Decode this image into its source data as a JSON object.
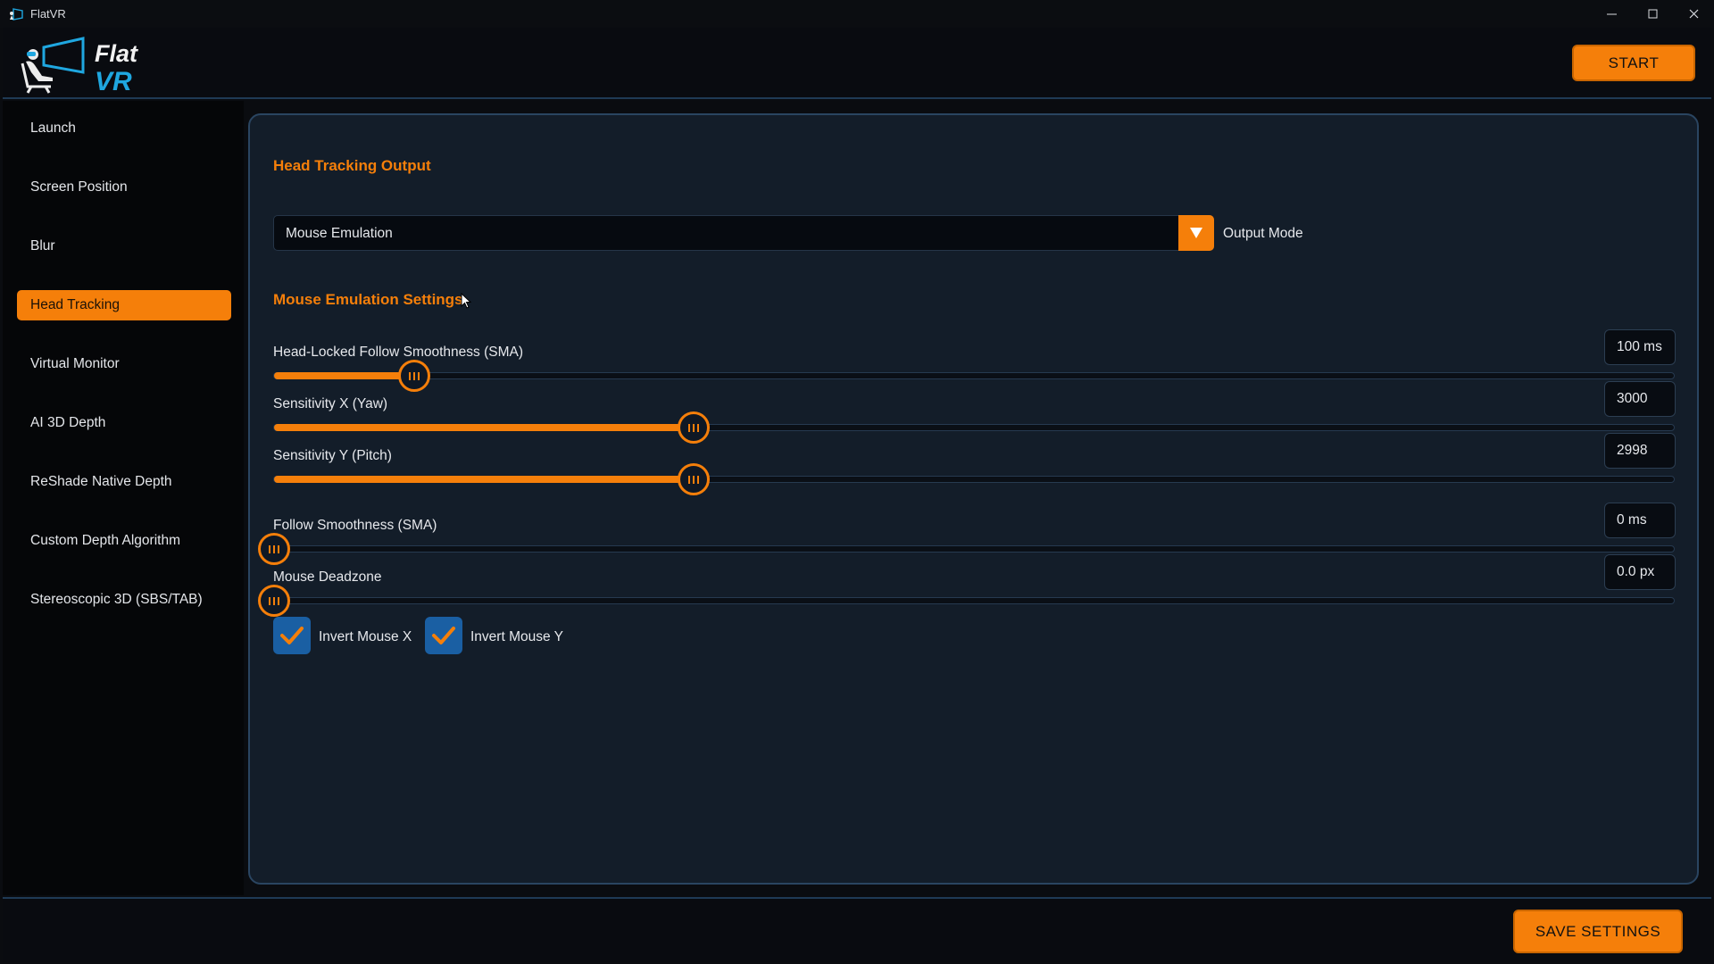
{
  "window": {
    "title": "FlatVR"
  },
  "header": {
    "logo_line1": "Flat",
    "logo_line2": "VR",
    "start_label": "START"
  },
  "sidebar": {
    "items": [
      {
        "label": "Launch",
        "active": false
      },
      {
        "label": "Screen Position",
        "active": false
      },
      {
        "label": "Blur",
        "active": false
      },
      {
        "label": "Head Tracking",
        "active": true
      },
      {
        "label": "Virtual Monitor",
        "active": false
      },
      {
        "label": "AI 3D Depth",
        "active": false
      },
      {
        "label": "ReShade Native Depth",
        "active": false
      },
      {
        "label": "Custom Depth Algorithm",
        "active": false
      },
      {
        "label": "Stereoscopic 3D (SBS/TAB)",
        "active": false
      }
    ]
  },
  "main": {
    "output_section_title": "Head Tracking Output",
    "output_mode": {
      "value": "Mouse Emulation",
      "label": "Output Mode"
    },
    "mouse_section_title": "Mouse Emulation Settings",
    "sliders": [
      {
        "label": "Head-Locked Follow Smoothness (SMA)",
        "value_text": "100 ms",
        "fraction": 0.1
      },
      {
        "label": "Sensitivity X (Yaw)",
        "value_text": "3000",
        "fraction": 0.3
      },
      {
        "label": "Sensitivity Y (Pitch)",
        "value_text": "2998",
        "fraction": 0.3
      },
      {
        "label": "Follow Smoothness (SMA)",
        "value_text": "0 ms",
        "fraction": 0.0
      },
      {
        "label": "Mouse Deadzone",
        "value_text": "0.0 px",
        "fraction": 0.0
      }
    ],
    "checkboxes": [
      {
        "label": "Invert Mouse X",
        "checked": true
      },
      {
        "label": "Invert Mouse Y",
        "checked": true
      }
    ]
  },
  "footer": {
    "save_label": "SAVE SETTINGS"
  },
  "colors": {
    "accent": "#f57f0a",
    "panel_bg": "#131d29",
    "checkbox_bg": "#1a5fa3",
    "logo_vr": "#1fa7e0"
  }
}
